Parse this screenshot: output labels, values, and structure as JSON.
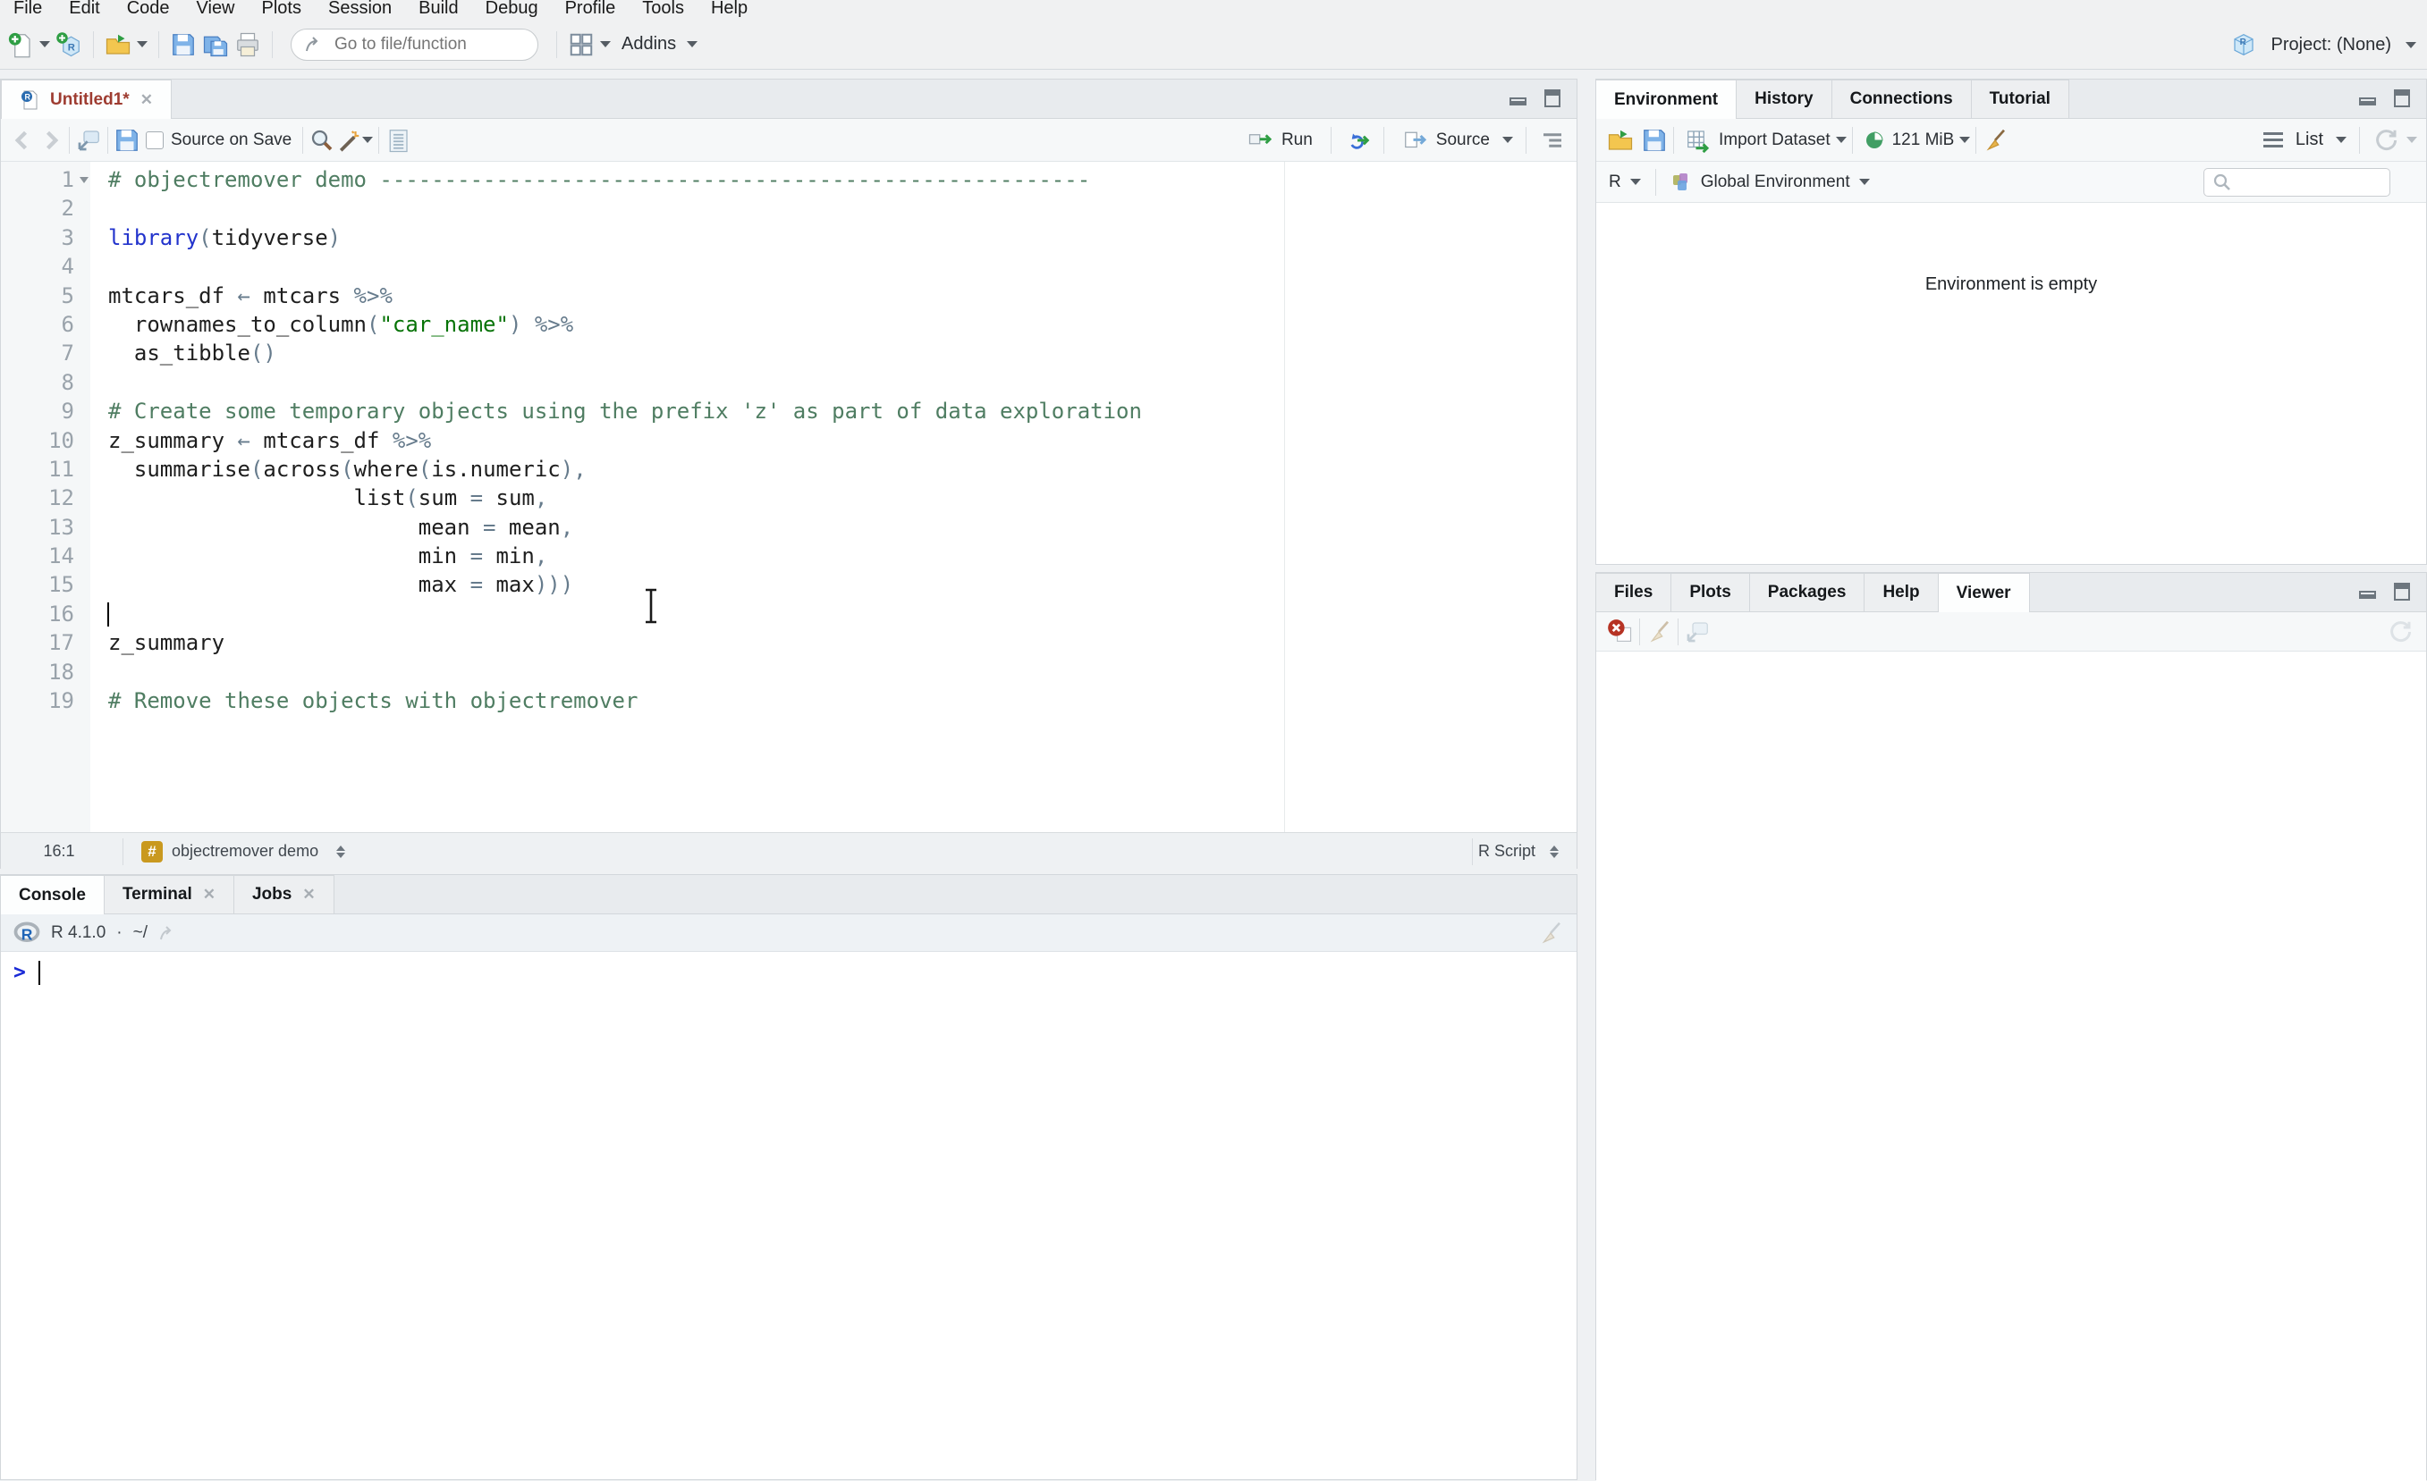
{
  "menu_bar": {
    "items": [
      "File",
      "Edit",
      "Code",
      "View",
      "Plots",
      "Session",
      "Build",
      "Debug",
      "Profile",
      "Tools",
      "Help"
    ]
  },
  "toolbar": {
    "goto_placeholder": "Go to file/function",
    "addins_label": "Addins",
    "project_label": "Project: (None)"
  },
  "source_pane": {
    "tab": {
      "title": "Untitled1*"
    },
    "toolbar": {
      "source_on_save": "Source on Save",
      "run_label": "Run",
      "source_label": "Source"
    },
    "status": {
      "cursor_pos": "16:1",
      "section_label": "objectremover demo",
      "file_type_label": "R Script"
    },
    "code": {
      "lines": [
        {
          "n": 1,
          "fold": true,
          "segs": [
            [
              "# objectremover demo -------------------------------------------------------",
              "c"
            ]
          ]
        },
        {
          "n": 2,
          "segs": []
        },
        {
          "n": 3,
          "segs": [
            [
              "library",
              "k"
            ],
            [
              "(",
              "o"
            ],
            [
              "tidyverse",
              "t"
            ],
            [
              ")",
              "o"
            ]
          ]
        },
        {
          "n": 4,
          "segs": []
        },
        {
          "n": 5,
          "segs": [
            [
              "mtcars_df ",
              "t"
            ],
            [
              "←",
              "o"
            ],
            [
              " mtcars ",
              "t"
            ],
            [
              "%>%",
              "o"
            ]
          ]
        },
        {
          "n": 6,
          "segs": [
            [
              "  rownames_to_column",
              "t"
            ],
            [
              "(",
              "o"
            ],
            [
              "\"car_name\"",
              "s"
            ],
            [
              ")",
              "o"
            ],
            [
              " ",
              "t"
            ],
            [
              "%>%",
              "o"
            ]
          ]
        },
        {
          "n": 7,
          "segs": [
            [
              "  as_tibble",
              "t"
            ],
            [
              "()",
              "o"
            ]
          ]
        },
        {
          "n": 8,
          "segs": []
        },
        {
          "n": 9,
          "segs": [
            [
              "# Create some temporary objects using the prefix 'z' as part of data exploration",
              "c"
            ]
          ]
        },
        {
          "n": 10,
          "segs": [
            [
              "z_summary ",
              "t"
            ],
            [
              "←",
              "o"
            ],
            [
              " mtcars_df ",
              "t"
            ],
            [
              "%>%",
              "o"
            ]
          ]
        },
        {
          "n": 11,
          "segs": [
            [
              "  summarise",
              "t"
            ],
            [
              "(",
              "o"
            ],
            [
              "across",
              "t"
            ],
            [
              "(",
              "o"
            ],
            [
              "where",
              "t"
            ],
            [
              "(",
              "o"
            ],
            [
              "is.numeric",
              "t"
            ],
            [
              "),",
              "o"
            ]
          ]
        },
        {
          "n": 12,
          "segs": [
            [
              "                   list",
              "t"
            ],
            [
              "(",
              "o"
            ],
            [
              "sum ",
              "t"
            ],
            [
              "=",
              "o"
            ],
            [
              " sum",
              "t"
            ],
            [
              ",",
              "o"
            ]
          ]
        },
        {
          "n": 13,
          "segs": [
            [
              "                        mean ",
              "t"
            ],
            [
              "=",
              "o"
            ],
            [
              " mean",
              "t"
            ],
            [
              ",",
              "o"
            ]
          ]
        },
        {
          "n": 14,
          "segs": [
            [
              "                        min ",
              "t"
            ],
            [
              "=",
              "o"
            ],
            [
              " min",
              "t"
            ],
            [
              ",",
              "o"
            ]
          ]
        },
        {
          "n": 15,
          "segs": [
            [
              "                        max ",
              "t"
            ],
            [
              "=",
              "o"
            ],
            [
              " max",
              "t"
            ],
            [
              ")))",
              "o"
            ]
          ]
        },
        {
          "n": 16,
          "caret": true,
          "segs": []
        },
        {
          "n": 17,
          "segs": [
            [
              "z_summary",
              "t"
            ]
          ]
        },
        {
          "n": 18,
          "segs": []
        },
        {
          "n": 19,
          "segs": [
            [
              "# Remove these objects with objectremover",
              "c"
            ]
          ]
        }
      ]
    }
  },
  "console_pane": {
    "tabs": [
      {
        "label": "Console",
        "active": true
      },
      {
        "label": "Terminal",
        "closable": true
      },
      {
        "label": "Jobs",
        "closable": true
      }
    ],
    "r_version": "R 4.1.0",
    "separator": "·",
    "working_dir": "~/",
    "prompt": ">"
  },
  "environment_pane": {
    "tabs": [
      {
        "label": "Environment",
        "active": true
      },
      {
        "label": "History"
      },
      {
        "label": "Connections"
      },
      {
        "label": "Tutorial"
      }
    ],
    "toolbar": {
      "import_label": "Import Dataset",
      "memory_label": "121 MiB",
      "list_label": "List"
    },
    "scope": {
      "language": "R",
      "environment": "Global Environment"
    },
    "empty_message": "Environment is empty"
  },
  "files_pane": {
    "tabs": [
      {
        "label": "Files"
      },
      {
        "label": "Plots"
      },
      {
        "label": "Packages"
      },
      {
        "label": "Help"
      },
      {
        "label": "Viewer",
        "active": true
      }
    ]
  },
  "colors": {
    "chrome": "#f0f1f2",
    "pane_gap": "#eff1f3",
    "strip": "#e8ebee",
    "strip_border": "#d3d7db",
    "toolbar_bg": "#f6f8f9",
    "border": "#d5d9dd",
    "status_bg": "#eef1f3",
    "gutter_bg": "#f5f7f8",
    "line_num": "#9aa3ab",
    "code_text": "#1e1e1e",
    "comment": "#4f7d62",
    "string": "#077307",
    "keyword": "#2233cc",
    "operator": "#667b8c",
    "prompt": "#1b2bd6",
    "modified_tab": "#9e3c31",
    "badge": "#c9991f",
    "run_green": "#2f9e44"
  }
}
